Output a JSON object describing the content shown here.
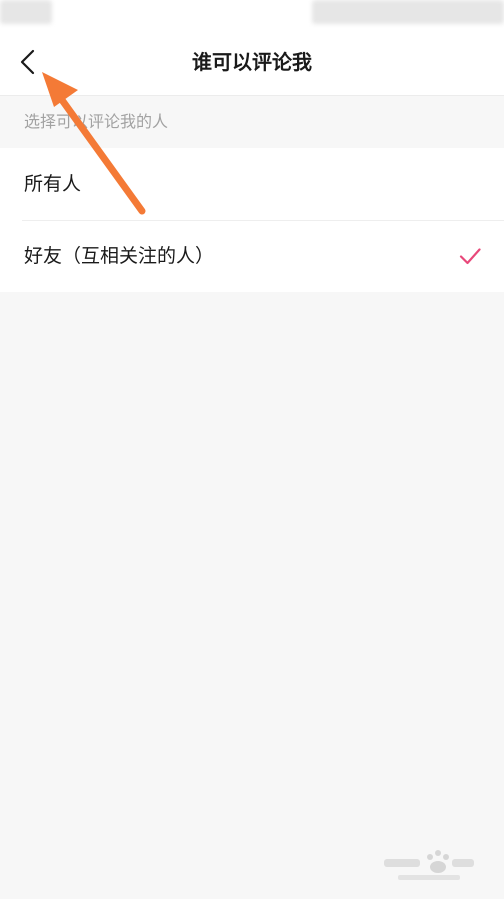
{
  "nav": {
    "title": "谁可以评论我",
    "back_icon": "chevron-left-icon"
  },
  "section": {
    "header": "选择可以评论我的人"
  },
  "options": [
    {
      "label": "所有人",
      "selected": false
    },
    {
      "label": "好友（互相关注的人）",
      "selected": true
    }
  ],
  "colors": {
    "accent": "#e8487a",
    "annotation_arrow": "#f47a36",
    "background": "#f7f7f7",
    "row": "#ffffff"
  },
  "annotation": {
    "icon": "orange-arrow-icon"
  }
}
